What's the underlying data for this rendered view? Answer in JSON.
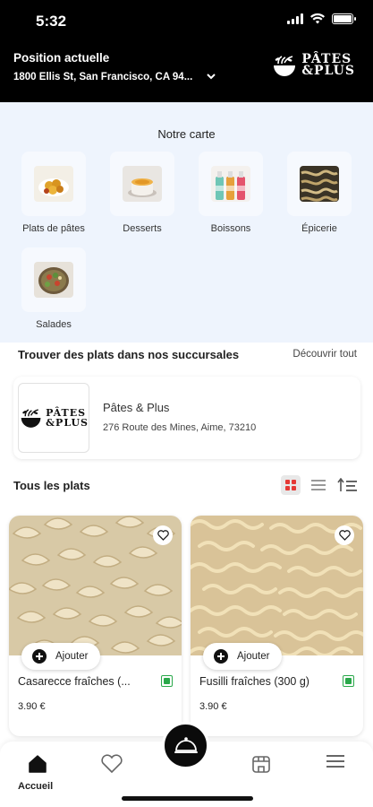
{
  "status_bar": {
    "time": "5:32"
  },
  "location": {
    "title": "Position actuelle",
    "address": "1800 Ellis St, San Francisco, CA 94..."
  },
  "brand": {
    "line1": "PÂTES",
    "line2": "&PLUS"
  },
  "menu": {
    "title": "Notre carte",
    "categories": [
      {
        "label": "Plats de pâtes"
      },
      {
        "label": "Desserts"
      },
      {
        "label": "Boissons"
      },
      {
        "label": "Épicerie"
      },
      {
        "label": "Salades"
      }
    ]
  },
  "branches": {
    "title": "Trouver des plats dans nos succursales",
    "see_all": "Découvrir tout",
    "card": {
      "name": "Pâtes & Plus",
      "address": "276 Route des Mines, Aime, 73210"
    }
  },
  "dishes": {
    "title": "Tous les plats",
    "add_label": "Ajouter",
    "items": [
      {
        "name": "Casarecce fraîches (...",
        "price": "3.90 €"
      },
      {
        "name": "Fusilli fraîches (300 g)",
        "price": "3.90 €"
      }
    ]
  },
  "bottom_nav": {
    "home_label": "Accueil"
  },
  "colors": {
    "header_bg": "#000000",
    "menu_bg": "#eef4fd",
    "veg_green": "#2aa84a",
    "grid_active": "#e53935"
  }
}
